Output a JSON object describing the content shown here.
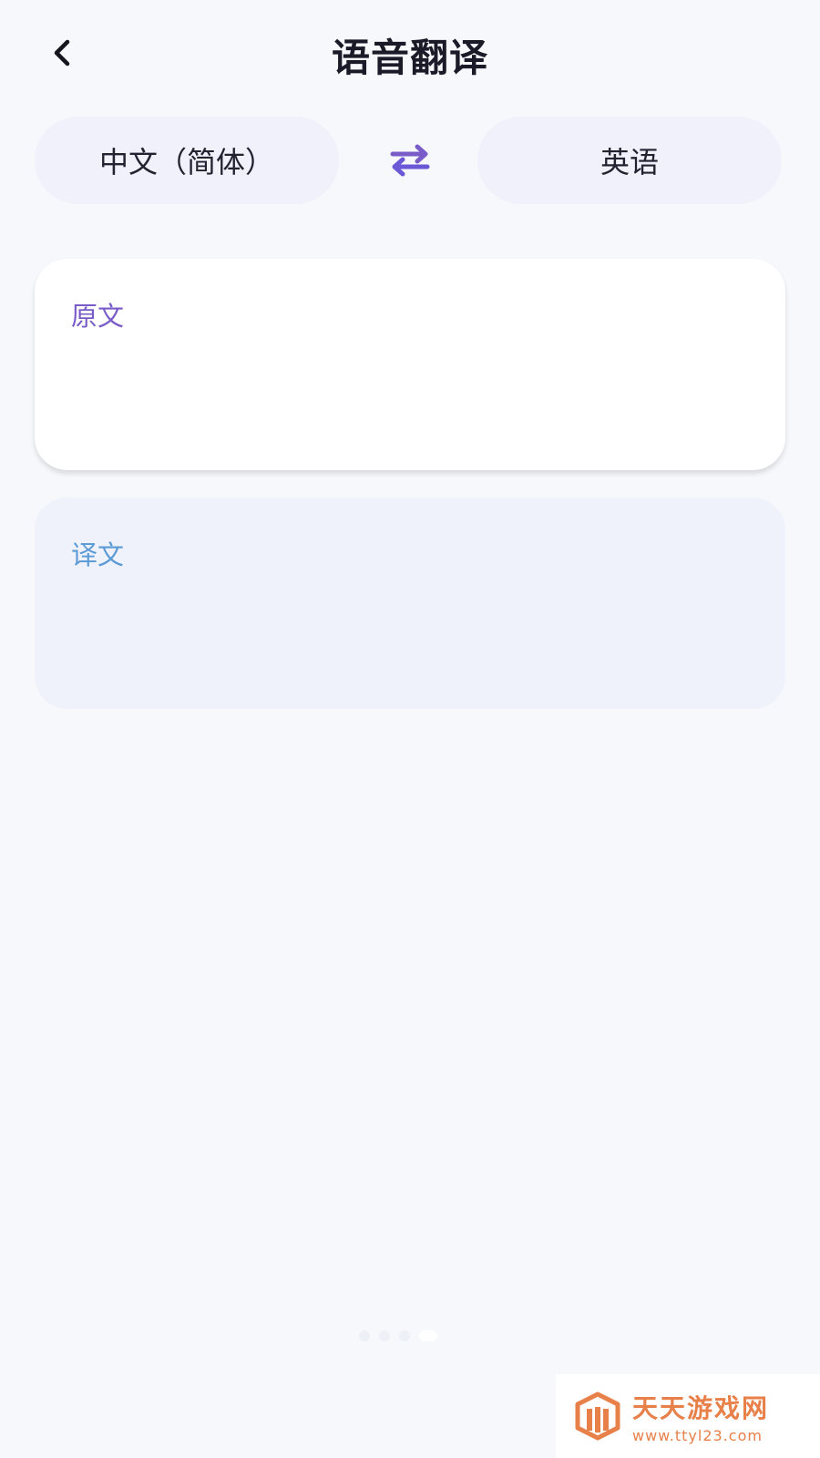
{
  "header": {
    "title": "语音翻译",
    "back_icon": "chevron-left-icon"
  },
  "languages": {
    "source": "中文（简体）",
    "target": "英语",
    "swap_icon": "swap-arrows-icon",
    "swap_color": "#7a5cc8"
  },
  "source_card": {
    "label": "原文",
    "text": ""
  },
  "target_card": {
    "label": "译文",
    "text": ""
  },
  "pager": {
    "count": 4,
    "active_index": 3
  },
  "watermark": {
    "title": "天天游戏网",
    "url": "www.ttyl23.com",
    "color": "#e8804a"
  }
}
